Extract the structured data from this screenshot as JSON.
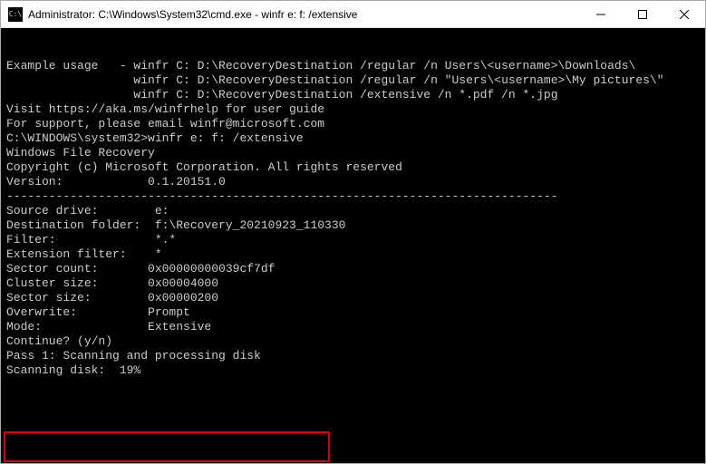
{
  "titlebar": {
    "icon_label": "C:\\",
    "title": "Administrator: C:\\Windows\\System32\\cmd.exe - winfr  e: f: /extensive"
  },
  "terminal": {
    "lines": [
      "Example usage   - winfr C: D:\\RecoveryDestination /regular /n Users\\<username>\\Downloads\\",
      "                  winfr C: D:\\RecoveryDestination /regular /n \"Users\\<username>\\My pictures\\\"",
      "                  winfr C: D:\\RecoveryDestination /extensive /n *.pdf /n *.jpg",
      "",
      "",
      "Visit https://aka.ms/winfrhelp for user guide",
      "For support, please email winfr@microsoft.com",
      "",
      "C:\\WINDOWS\\system32>winfr e: f: /extensive",
      "",
      "Windows File Recovery",
      "Copyright (c) Microsoft Corporation. All rights reserved",
      "Version:            0.1.20151.0",
      "------------------------------------------------------------------------------",
      "",
      "Source drive:        e:",
      "Destination folder:  f:\\Recovery_20210923_110330",
      "Filter:              *.*",
      "Extension filter:    *",
      "",
      "Sector count:       0x00000000039cf7df",
      "Cluster size:       0x00004000",
      "Sector size:        0x00000200",
      "Overwrite:          Prompt",
      "Mode:               Extensive",
      "",
      "",
      "Continue? (y/n)",
      "Pass 1: Scanning and processing disk",
      "Scanning disk:  19%"
    ]
  }
}
